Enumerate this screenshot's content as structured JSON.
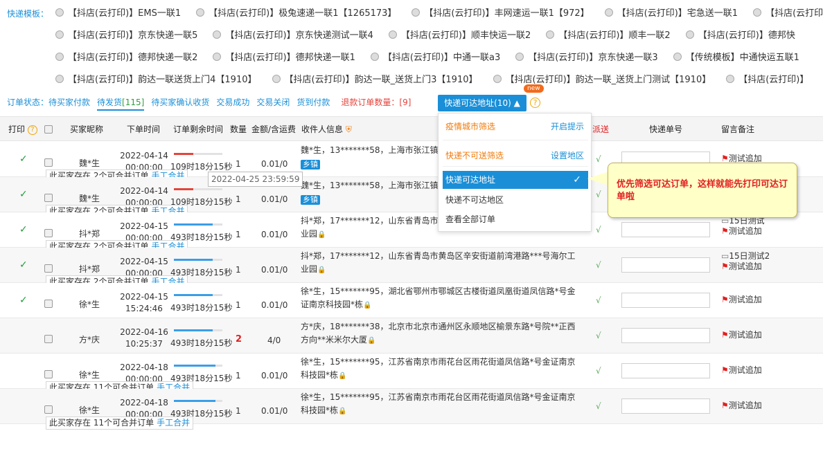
{
  "template": {
    "label": "快递模板：",
    "rows": [
      [
        "【抖店(云打印)】EMS一联1",
        "【抖店(云打印)】极兔速递一联1【1265173】",
        "【抖店(云打印)】丰网速运一联1【972】",
        "【抖店(云打印)】宅急送一联1",
        "【抖店(云打印)】"
      ],
      [
        "【抖店(云打印)】京东快递一联5",
        "【抖店(云打印)】京东快递测试一联4",
        "【抖店(云打印)】顺丰快运一联2",
        "【抖店(云打印)】顺丰一联2",
        "【抖店(云打印)】德邦快"
      ],
      [
        "【抖店(云打印)】德邦快递一联2",
        "【抖店(云打印)】德邦快递一联1",
        "【抖店(云打印)】中通一联a3",
        "【抖店(云打印)】京东快递一联3",
        "【传统模板】中通快运五联1"
      ],
      [
        "【抖店(云打印)】韵达一联送货上门4【1910】",
        "【抖店(云打印)】韵达一联_送货上门3【1910】",
        "【抖店(云打印)】韵达一联_送货上门测试【1910】",
        "【抖店(云打印)】"
      ]
    ]
  },
  "status": {
    "label": "订单状态：",
    "items": [
      "待买家付款",
      "待发货",
      "待买家确认收货",
      "交易成功",
      "交易关闭",
      "货到付款"
    ],
    "pending_count": "[115]",
    "refund_label": "退款订单数量：",
    "refund_count": "[9]"
  },
  "filter_button": {
    "label": "快递可达地址(10) ▲",
    "badge": "new",
    "help": "?"
  },
  "headers": {
    "print": "打印",
    "buyer": "买家昵称",
    "time": "下单时间",
    "remain": "订单剩余时间",
    "qty": "数量",
    "amount": "金额/含运费",
    "receiver": "收件人信息",
    "send": "派送",
    "tracking": "快递单号",
    "note": "留言备注"
  },
  "rows": [
    {
      "printed": true,
      "buyer": "魏*生",
      "date": "2022-04-14",
      "time": "00:00:00",
      "remain": "109时18分15秒",
      "qty": "1",
      "amount": "0.01/0",
      "addr": "魏*生，13*******58，上海市张江镇",
      "tag": "乡镇",
      "merge": "此买家存在 2个可合并订单",
      "merge_link": "手工合并",
      "note1": "",
      "note2": "测试追加",
      "bar_pct": 0.4,
      "bar_color": "#e4443c"
    },
    {
      "printed": true,
      "buyer": "魏*生",
      "date": "2022-04-14",
      "time": "00:00:00",
      "remain": "109时18分15秒",
      "qty": "1",
      "amount": "0.01/0",
      "addr": "魏*生，13*******58，上海市张江镇",
      "tag": "乡镇",
      "merge": "此买家存在 2个可合并订单",
      "merge_link": "手工合并",
      "note1": "",
      "note2": "测试追加",
      "bar_pct": 0.4,
      "bar_color": "#e4443c"
    },
    {
      "printed": true,
      "buyer": "抖*郑",
      "date": "2022-04-15",
      "time": "00:00:00",
      "remain": "493时18分15秒",
      "qty": "1",
      "amount": "0.01/0",
      "addr": "抖*郑，17*******12，山东省青岛市黄岛区辛安街道前湾港路***号海尔工业园",
      "tag": "",
      "merge": "此买家存在 2个可合并订单",
      "merge_link": "手工合并",
      "note1": "15日测试",
      "note2": "测试追加",
      "bar_pct": 0.8,
      "bar_color": "#3a9ee8"
    },
    {
      "printed": true,
      "buyer": "抖*郑",
      "date": "2022-04-15",
      "time": "00:00:00",
      "remain": "493时18分15秒",
      "qty": "1",
      "amount": "0.01/0",
      "addr": "抖*郑，17*******12，山东省青岛市黄岛区辛安街道前湾港路***号海尔工业园",
      "tag": "",
      "merge": "此买家存在 2个可合并订单",
      "merge_link": "手工合并",
      "note1": "15日测试2",
      "note2": "测试追加",
      "bar_pct": 0.8,
      "bar_color": "#3a9ee8"
    },
    {
      "printed": true,
      "buyer": "徐*生",
      "date": "2022-04-15",
      "time": "15:24:46",
      "remain": "493时18分15秒",
      "qty": "1",
      "amount": "0.01/0",
      "addr": "徐*生，15*******95，湖北省鄂州市鄂城区古楼街道凤凰街道凤信路*号金证南京科技园*栋",
      "tag": "",
      "merge": "",
      "merge_link": "",
      "note1": "",
      "note2": "测试追加",
      "bar_pct": 0.8,
      "bar_color": "#3a9ee8"
    },
    {
      "printed": false,
      "buyer": "方*庆",
      "date": "2022-04-16",
      "time": "10:25:37",
      "remain": "493时18分15秒",
      "qty": "2",
      "amount": "4/0",
      "addr": "方*庆，18*******38，北京市北京市通州区永顺地区榆景东路*号院**正西方向**米米尔大厦",
      "tag": "",
      "merge": "",
      "merge_link": "",
      "note1": "",
      "note2": "测试追加",
      "bar_pct": 0.8,
      "bar_color": "#3a9ee8"
    },
    {
      "printed": false,
      "buyer": "徐*生",
      "date": "2022-04-18",
      "time": "00:00:00",
      "remain": "493时18分15秒",
      "qty": "1",
      "amount": "0.01/0",
      "addr": "徐*生，15*******95，江苏省南京市雨花台区雨花街道凤信路*号金证南京科技园*栋",
      "tag": "",
      "merge": "此买家存在 11个可合并订单",
      "merge_link": "手工合并",
      "note1": "",
      "note2": "测试追加",
      "bar_pct": 0.85,
      "bar_color": "#3a9ee8"
    },
    {
      "printed": false,
      "buyer": "徐*生",
      "date": "2022-04-18",
      "time": "00:00:00",
      "remain": "493时18分15秒",
      "qty": "1",
      "amount": "0.01/0",
      "addr": "徐*生，15*******95，江苏省南京市雨花台区雨花街道凤信路*号金证南京科技园*栋",
      "tag": "",
      "merge": "此买家存在 11个可合并订单",
      "merge_link": "手工合并",
      "note1": "",
      "note2": "测试追加",
      "bar_pct": 0.85,
      "bar_color": "#3a9ee8"
    }
  ],
  "tooltip": "2022-04-25 23:59:59",
  "menu": {
    "item1": "疫情城市筛选",
    "link1": "开启提示",
    "item2": "快递不可送筛选",
    "link2": "设置地区",
    "selected": "快递可达地址",
    "item4": "快递不可达地区",
    "item5": "查看全部订单"
  },
  "callout": "优先筛选可达订单，这样就能先打印可达订单啦"
}
